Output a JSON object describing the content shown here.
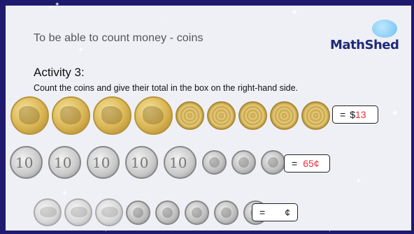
{
  "slide": {
    "objective": "To be able to count money - coins",
    "logo": "MathShed",
    "activity_title": "Activity 3:",
    "instructions": "Count the coins and give their total in the box on the right-hand side."
  },
  "rows": [
    {
      "coins": [
        "one-dollar",
        "one-dollar",
        "one-dollar",
        "one-dollar",
        "two-dollar",
        "two-dollar",
        "two-dollar",
        "two-dollar",
        "two-dollar"
      ],
      "answer": {
        "eq": "=",
        "prefix": "$",
        "value": "13",
        "suffix": ""
      }
    },
    {
      "coins": [
        "ten-cent",
        "ten-cent",
        "ten-cent",
        "ten-cent",
        "ten-cent",
        "five-cent",
        "five-cent",
        "five-cent"
      ],
      "answer": {
        "eq": "=",
        "prefix": "",
        "value": "65",
        "suffix": "¢"
      }
    },
    {
      "coins": [
        "twenty-cent",
        "twenty-cent",
        "twenty-cent",
        "five-cent",
        "five-cent",
        "five-cent",
        "five-cent",
        "five-cent"
      ],
      "answer": {
        "eq": "=",
        "prefix": "",
        "value": "",
        "suffix": "¢"
      }
    }
  ],
  "colors": {
    "background": "#1f1a6e",
    "slide": "#eef0f6",
    "answer": "#e8313f",
    "logo": "#1f2a7a"
  }
}
